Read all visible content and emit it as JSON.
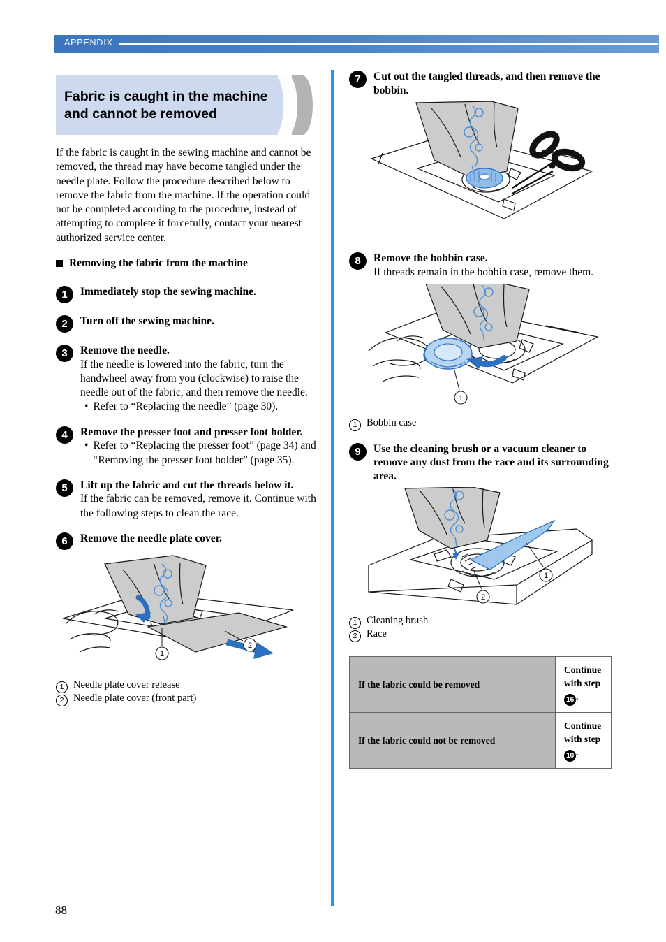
{
  "header": {
    "label": "APPENDIX"
  },
  "page": {
    "number": "88"
  },
  "colors": {
    "header_band": "#4a83c6",
    "divider": "#2196f3",
    "title_box": "#ccd9ef",
    "table_header_fill": "#b9b9b9",
    "illustration_accent": "#4a90d9",
    "illustration_fabric": "#cccccc"
  },
  "left_column": {
    "section_title": "Fabric is caught in the machine and cannot be removed",
    "intro_paragraph": "If the fabric is caught in the sewing machine and cannot be removed, the thread may have become tangled under the needle plate. Follow the procedure described below to remove the fabric from the machine. If the operation could not be completed according to the procedure, instead of attempting to complete it forcefully, contact your nearest authorized service center.",
    "subheading": "Removing the fabric from the machine",
    "steps": [
      {
        "number": "1",
        "title": "Immediately stop the sewing machine.",
        "body": "",
        "bullets": []
      },
      {
        "number": "2",
        "title": "Turn off the sewing machine.",
        "body": "",
        "bullets": []
      },
      {
        "number": "3",
        "title": "Remove the needle.",
        "body": "If the needle is lowered into the fabric, turn the handwheel away from you (clockwise) to raise the needle out of the fabric, and then remove the needle.",
        "bullets": [
          "Refer to “Replacing the needle” (page 30)."
        ]
      },
      {
        "number": "4",
        "title": "Remove the presser foot and presser foot holder.",
        "body": "",
        "bullets": [
          "Refer to “Replacing the presser foot” (page 34) and “Removing the presser foot holder” (page 35)."
        ]
      },
      {
        "number": "5",
        "title": "Lift up the fabric and cut the threads below it.",
        "body": "If the fabric can be removed, remove it. Continue with the following steps to clean the race.",
        "bullets": []
      },
      {
        "number": "6",
        "title": "Remove the needle plate cover.",
        "body": "",
        "bullets": []
      }
    ],
    "figure_6": {
      "alt": "needle-plate-cover-removal-illustration",
      "callouts": [
        {
          "num": "1",
          "label": "Needle plate cover release"
        },
        {
          "num": "2",
          "label": "Needle plate cover (front part)"
        }
      ]
    }
  },
  "right_column": {
    "steps": [
      {
        "number": "7",
        "title": "Cut out the tangled threads, and then remove the bobbin.",
        "body": "",
        "bullets": []
      },
      {
        "number": "8",
        "title": "Remove the bobbin case.",
        "body": "If threads remain in the bobbin case, remove them.",
        "bullets": []
      },
      {
        "number": "9",
        "title": "Use the cleaning brush or a vacuum cleaner to remove any dust from the race and its surrounding area.",
        "body": "",
        "bullets": []
      }
    ],
    "figure_7": {
      "alt": "cut-tangled-threads-scissors-illustration",
      "callouts": []
    },
    "figure_8": {
      "alt": "remove-bobbin-case-illustration",
      "callouts": [
        {
          "num": "1",
          "label": "Bobbin case"
        }
      ]
    },
    "figure_9": {
      "alt": "cleaning-brush-race-illustration",
      "callouts": [
        {
          "num": "1",
          "label": "Cleaning brush"
        },
        {
          "num": "2",
          "label": "Race"
        }
      ]
    },
    "result_table": {
      "rows": [
        {
          "condition": "If the fabric could be removed",
          "action_prefix": "Continue with step",
          "action_step": "16",
          "action_suffix": "."
        },
        {
          "condition": "If the fabric could not be removed",
          "action_prefix": "Continue with step",
          "action_step": "10",
          "action_suffix": "."
        }
      ]
    }
  }
}
